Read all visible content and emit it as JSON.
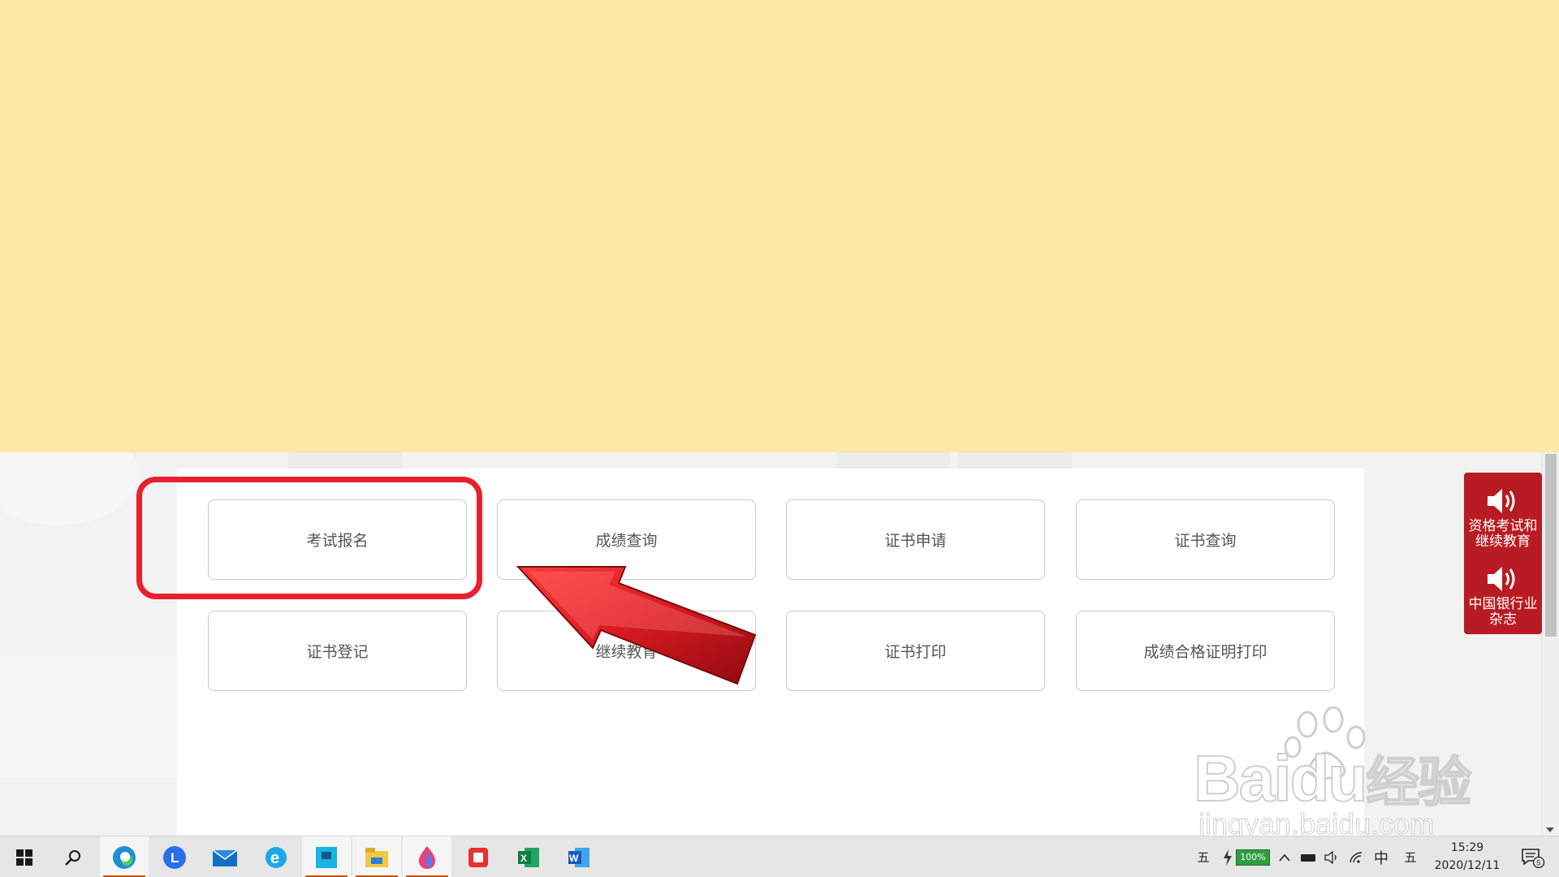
{
  "menu": {
    "buttons": [
      {
        "label": "考试报名"
      },
      {
        "label": "成绩查询"
      },
      {
        "label": "证书申请"
      },
      {
        "label": "证书查询"
      },
      {
        "label": "证书登记"
      },
      {
        "label": "继续教育"
      },
      {
        "label": "证书打印"
      },
      {
        "label": "成绩合格证明打印"
      }
    ]
  },
  "float_panel": {
    "items": [
      {
        "label": "资格考试和继续教育",
        "icon": "speaker-icon"
      },
      {
        "label": "中国银行业杂志",
        "icon": "speaker-icon"
      }
    ],
    "color": "#b81c22"
  },
  "annotation": {
    "highlight_color": "#e8212e",
    "arrow_color": "#d71920",
    "highlighted_item": "考试报名"
  },
  "watermark": {
    "brand": "Bai",
    "brand_suffix": "du",
    "brand_cn": "经验",
    "url": "jingyan.baidu.com"
  },
  "taskbar": {
    "apps": [
      {
        "icon": "windows-start-icon"
      },
      {
        "icon": "search-icon"
      },
      {
        "icon": "edge-browser-icon",
        "active": true
      },
      {
        "icon": "lenovo-app-icon"
      },
      {
        "icon": "mail-icon"
      },
      {
        "icon": "ie-browser-icon"
      },
      {
        "icon": "pinned-app-icon",
        "active": true
      },
      {
        "icon": "file-explorer-icon",
        "active": true
      },
      {
        "icon": "paint-drop-icon",
        "active": true
      },
      {
        "icon": "record-app-icon"
      },
      {
        "icon": "excel-icon"
      },
      {
        "icon": "word-icon"
      }
    ],
    "tray": {
      "ime_mode": "五",
      "battery": "100%",
      "language": "中",
      "ime_mode_2": "五",
      "time": "15:29",
      "date": "2020/12/11",
      "notifications": "5"
    }
  }
}
